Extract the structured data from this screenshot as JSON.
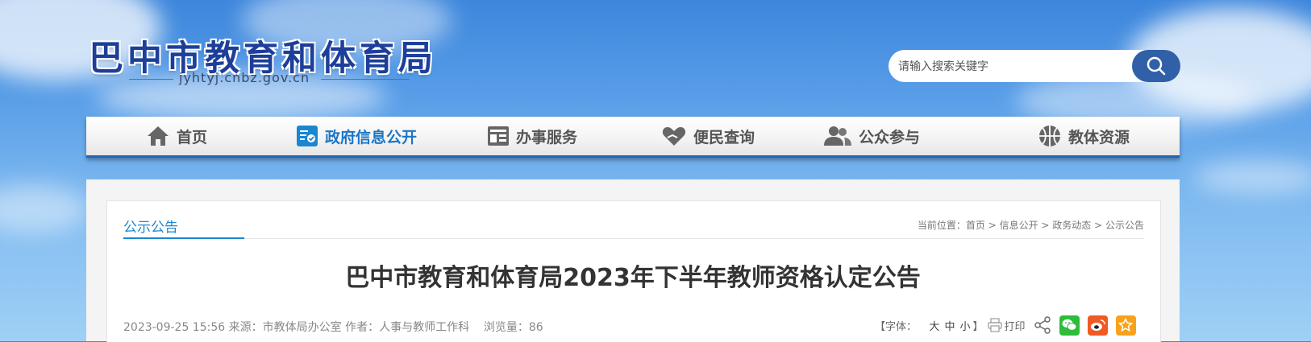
{
  "header": {
    "site_title": "巴中市教育和体育局",
    "site_domain": "jyhtyj.cnbz.gov.cn",
    "search": {
      "placeholder": "请输入搜索关键字",
      "value": "",
      "button_icon": "search-icon"
    }
  },
  "nav": {
    "items": [
      {
        "label": "首页",
        "icon": "home-icon",
        "active": false
      },
      {
        "label": "政府信息公开",
        "icon": "gov-info-icon",
        "active": true
      },
      {
        "label": "办事服务",
        "icon": "service-icon",
        "active": false
      },
      {
        "label": "便民查询",
        "icon": "heart-hand-icon",
        "active": false
      },
      {
        "label": "公众参与",
        "icon": "people-icon",
        "active": false
      },
      {
        "label": "教体资源",
        "icon": "basketball-icon",
        "active": false
      }
    ]
  },
  "section": {
    "title": "公示公告"
  },
  "breadcrumb": {
    "prefix": "当前位置：",
    "items": [
      "首页",
      "信息公开",
      "政务动态",
      "公示公告"
    ],
    "separator": " > "
  },
  "article": {
    "title": "巴中市教育和体育局2023年下半年教师资格认定公告",
    "date": "2023-09-25 15:56",
    "source_label": "来源：",
    "source": "市教体局办公室",
    "author_label": "作者：",
    "author": "人事与教师工作科",
    "views_label": "浏览量：",
    "views": "86"
  },
  "tools": {
    "font_label": "【字体：",
    "size_large": "大",
    "size_medium": "中",
    "size_small": "小",
    "font_close": "】",
    "print_label": "打印"
  },
  "colors": {
    "accent": "#1a86d0",
    "nav_active": "#1a76c7",
    "search_button": "#3060a8",
    "wechat": "#2dbd3a",
    "weibo": "#f05a24",
    "favorite": "#f7a21b"
  }
}
